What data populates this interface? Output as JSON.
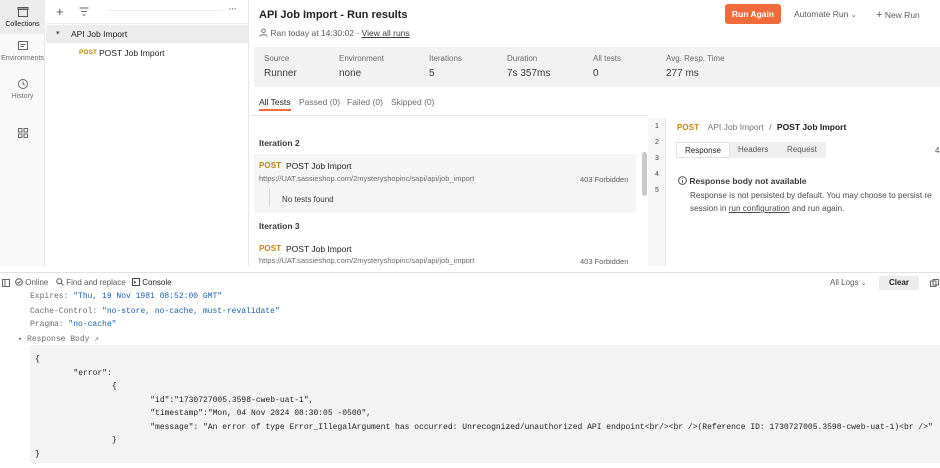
{
  "sidebar": {
    "items": [
      {
        "label": "Collections",
        "icon": "collections-icon"
      },
      {
        "label": "Environments",
        "icon": "environments-icon"
      },
      {
        "label": "History",
        "icon": "history-icon"
      },
      {
        "label": "",
        "icon": "apps-grid-icon"
      }
    ]
  },
  "tree": {
    "collection": "API Job Import",
    "request_method": "POST",
    "request_name": "POST Job Import"
  },
  "header": {
    "title": "API Job Import - Run results",
    "ran_text": "Ran today at 14:30:02",
    "sep": "·",
    "view_all": "View all runs",
    "run_again": "Run Again",
    "automate_run": "Automate Run",
    "new_run": "New Run"
  },
  "summary": [
    {
      "label": "Source",
      "value": "Runner"
    },
    {
      "label": "Environment",
      "value": "none"
    },
    {
      "label": "Iterations",
      "value": "5"
    },
    {
      "label": "Duration",
      "value": "7s 357ms"
    },
    {
      "label": "All tests",
      "value": "0"
    },
    {
      "label": "Avg. Resp. Time",
      "value": "277 ms"
    }
  ],
  "tabs": [
    "All Tests",
    "Passed (0)",
    "Failed (0)",
    "Skipped (0)"
  ],
  "iterations": [
    {
      "title": "Iteration 2",
      "method": "POST",
      "name": "POST Job Import",
      "url": "https://UAT.sassieshop.com/2mysteryshopinc/sapi/api/job_import",
      "status": "403 Forbidden",
      "tests": "No tests found"
    },
    {
      "title": "Iteration 3",
      "method": "POST",
      "name": "POST Job Import",
      "url": "https://UAT.sassieshop.com/2mysteryshopinc/sapi/api/job_import",
      "status": "403 Forbidden"
    }
  ],
  "line_numbers": [
    "1",
    "2",
    "3",
    "4",
    "5"
  ],
  "detail": {
    "method": "POST",
    "collection": "API Job Import",
    "sep": "/",
    "request": "POST Job Import",
    "tabs": [
      "Response",
      "Headers",
      "Request"
    ],
    "right_num": "4",
    "not_available": "Response body not available",
    "line1": "Response is not persisted by default. You may choose to persist re",
    "line2_pre": "session in",
    "link": "run configuration",
    "line2_post": "and run again."
  },
  "statusbar": {
    "online": "Online",
    "find": "Find and replace",
    "console": "Console",
    "all_logs": "All Logs",
    "clear": "Clear"
  },
  "console": {
    "headers": [
      {
        "key": "Expires:",
        "value": "\"Thu, 19 Nov 1981 08:52:00 GMT\""
      },
      {
        "key": "Cache-Control:",
        "value": "\"no-store, no-cache, must-revalidate\""
      },
      {
        "key": "Pragma:",
        "value": "\"no-cache\""
      }
    ],
    "response_body_label": "Response Body",
    "code_lines": [
      "{",
      "        \"error\":",
      "                {",
      "                        \"id\":\"1730727005.3598-cweb-uat-1\",",
      "                        \"timestamp\":\"Mon, 04 Nov 2024 08:30:05 -0500\",",
      "                        \"message\": \"An error of type Error_IllegalArgument has occurred: Unrecognized/unauthorized API endpoint<br/><br />(Reference ID: 1730727005.3598-cweb-uat-1)<br />\"",
      "                }",
      "}"
    ]
  },
  "colors": {
    "accent": "#f26b3a",
    "method_post": "#c0860b",
    "link": "#1a5fa8"
  }
}
